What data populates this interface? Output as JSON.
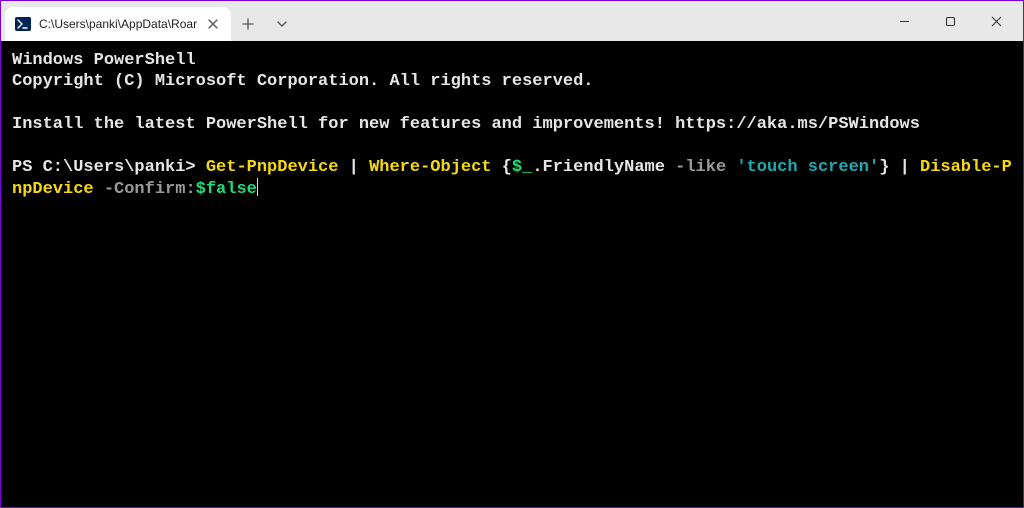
{
  "window": {
    "title": "C:\\Users\\panki\\AppData\\Roar",
    "icon_name": "powershell-icon"
  },
  "terminal": {
    "lines": {
      "l1": "Windows PowerShell",
      "l2": "Copyright (C) Microsoft Corporation. All rights reserved.",
      "l3": "",
      "l4": "Install the latest PowerShell for new features and improvements! https://aka.ms/PSWindows",
      "l5": ""
    },
    "prompt": "PS C:\\Users\\panki> ",
    "cmd": {
      "t1": "Get-PnpDevice",
      "t2": " | ",
      "t3": "Where-Object",
      "t4": " {",
      "t5": "$_",
      "t6": ".FriendlyName ",
      "t7": "-like",
      "t8": " ",
      "t9": "'touch screen'",
      "t10": "} | ",
      "t11": "Dis",
      "t12": "able-PnpDevice",
      "t13": " ",
      "t14": "-Confirm:",
      "t15": "$false"
    }
  },
  "colors": {
    "accent": "#012456",
    "yellow": "#f5d90a",
    "green": "#1ddb7a",
    "gray": "#9a9a9a",
    "teal": "#1fa9b0"
  }
}
